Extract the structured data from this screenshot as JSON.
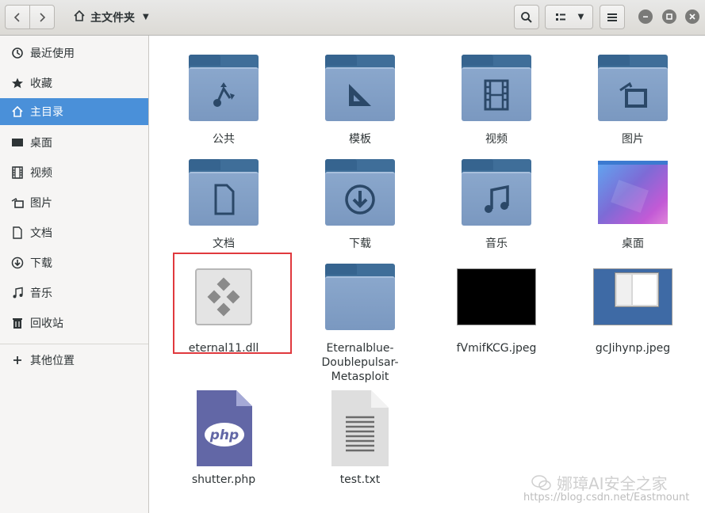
{
  "header": {
    "location": "主文件夹"
  },
  "sidebar": {
    "items": [
      {
        "label": "最近使用",
        "icon": "recent-icon"
      },
      {
        "label": "收藏",
        "icon": "star-icon"
      },
      {
        "label": "主目录",
        "icon": "home-icon",
        "active": true
      },
      {
        "label": "桌面",
        "icon": "desktop-icon"
      },
      {
        "label": "视频",
        "icon": "video-icon"
      },
      {
        "label": "图片",
        "icon": "picture-icon"
      },
      {
        "label": "文档",
        "icon": "document-icon"
      },
      {
        "label": "下载",
        "icon": "download-icon"
      },
      {
        "label": "音乐",
        "icon": "music-icon"
      },
      {
        "label": "回收站",
        "icon": "trash-icon"
      },
      {
        "label": "其他位置",
        "icon": "plus-icon"
      }
    ]
  },
  "files": [
    {
      "name": "公共",
      "type": "folder",
      "emblem": "share-icon"
    },
    {
      "name": "模板",
      "type": "folder",
      "emblem": "template-icon"
    },
    {
      "name": "视频",
      "type": "folder",
      "emblem": "video-icon"
    },
    {
      "name": "图片",
      "type": "folder",
      "emblem": "picture-icon"
    },
    {
      "name": "文档",
      "type": "folder",
      "emblem": "document-icon"
    },
    {
      "name": "下载",
      "type": "folder",
      "emblem": "download-icon"
    },
    {
      "name": "音乐",
      "type": "folder",
      "emblem": "music-icon"
    },
    {
      "name": "桌面",
      "type": "desktop-thumbnail"
    },
    {
      "name": "eternal11.dll",
      "type": "dll",
      "highlighted": true
    },
    {
      "name": "Eternalblue-Doublepulsar-Metasploit",
      "type": "folder"
    },
    {
      "name": "fVmifKCG.jpeg",
      "type": "image-black"
    },
    {
      "name": "gcJihynp.jpeg",
      "type": "image-screenshot"
    },
    {
      "name": "shutter.php",
      "type": "php",
      "badge": "php"
    },
    {
      "name": "test.txt",
      "type": "text"
    }
  ],
  "watermark": {
    "text": "娜璋AI安全之家",
    "url": "https://blog.csdn.net/Eastmount"
  },
  "colors": {
    "accent": "#4a90d9",
    "folder": "#7a98c0",
    "highlight": "#e0393e"
  }
}
